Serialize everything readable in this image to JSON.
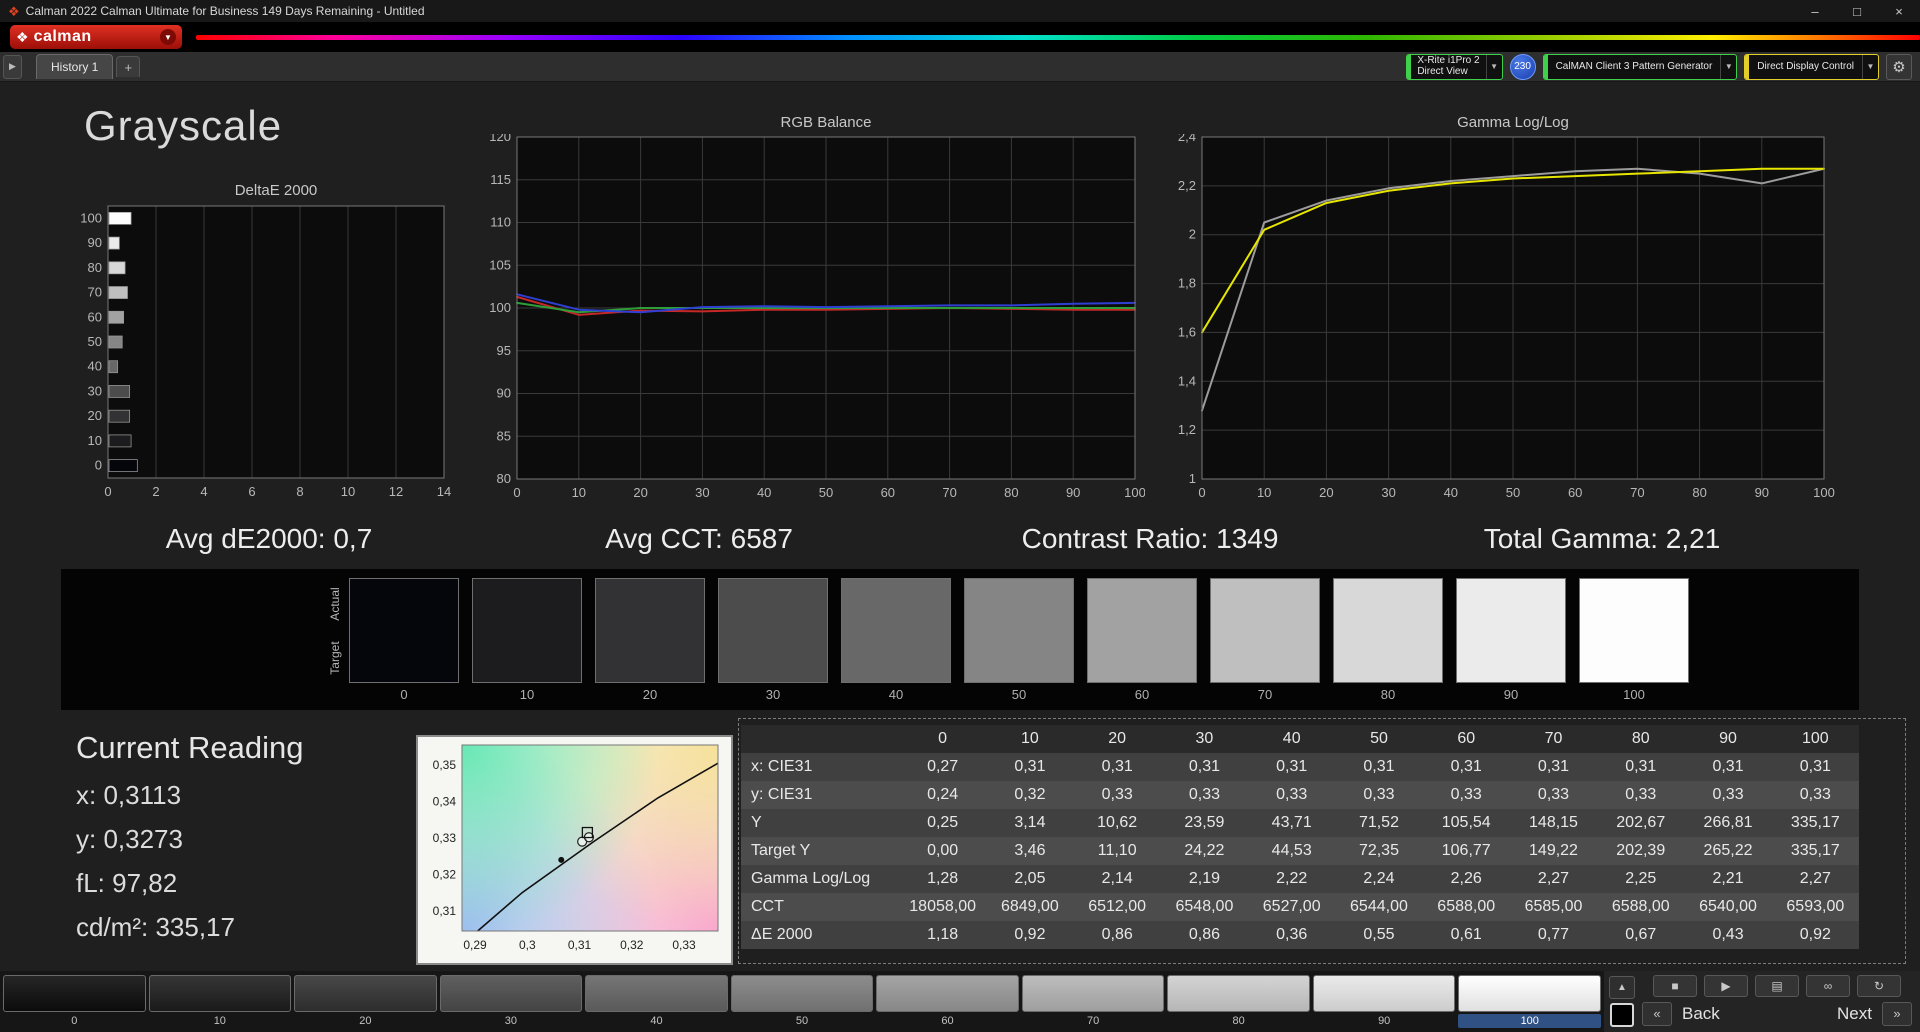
{
  "window": {
    "title": "Calman 2022 Calman Ultimate for Business 149 Days Remaining  - Untitled"
  },
  "brand": {
    "wordmark": "calman"
  },
  "icons": {
    "app": "❖",
    "minimize": "–",
    "maximize": "□",
    "close": "×",
    "chevron_down": "▼",
    "tab_arrow": "▶",
    "plus": "+",
    "gear": "⚙",
    "eject": "▲",
    "stop": "■",
    "play": "▶",
    "save": "▤",
    "infinity": "∞",
    "refresh": "↻",
    "back_chevrons": "«",
    "next_chevrons": "»"
  },
  "toolbar": {
    "history_tab": "History 1",
    "meter_line1": "X-Rite i1Pro 2",
    "meter_line2": "Direct View",
    "meter_badge": "230",
    "pattern_generator": "CalMAN Client 3 Pattern Generator",
    "display_control": "Direct Display Control"
  },
  "colors": {
    "accent_green": "#3fd14a",
    "accent_yellow": "#e3cf2a",
    "badge_blue": "#2255cc",
    "brand_red": "#c0150c"
  },
  "page": {
    "title": "Grayscale"
  },
  "stats": [
    "Avg dE2000: 0,7",
    "Avg CCT: 6587",
    "Contrast Ratio: 1349",
    "Total Gamma: 2,21"
  ],
  "swatch_strip": {
    "actual_label": "Actual",
    "target_label": "Target",
    "levels": [
      "0",
      "10",
      "20",
      "30",
      "40",
      "50",
      "60",
      "70",
      "80",
      "90",
      "100"
    ],
    "colors": [
      "#05050c",
      "#1c1c1e",
      "#323234",
      "#4c4c4c",
      "#686868",
      "#858585",
      "#a2a2a2",
      "#bfbfbf",
      "#d8d8d8",
      "#ebebeb",
      "#fdfdfd"
    ]
  },
  "current_reading": {
    "title": "Current Reading",
    "lines": [
      "x: 0,3113",
      "y: 0,3273",
      "fL: 97,82",
      "cd/m²: 335,17"
    ]
  },
  "table": {
    "columns": [
      "0",
      "10",
      "20",
      "30",
      "40",
      "50",
      "60",
      "70",
      "80",
      "90",
      "100"
    ],
    "rows": [
      {
        "label": "x: CIE31",
        "values": [
          "0,27",
          "0,31",
          "0,31",
          "0,31",
          "0,31",
          "0,31",
          "0,31",
          "0,31",
          "0,31",
          "0,31",
          "0,31"
        ]
      },
      {
        "label": "y: CIE31",
        "values": [
          "0,24",
          "0,32",
          "0,33",
          "0,33",
          "0,33",
          "0,33",
          "0,33",
          "0,33",
          "0,33",
          "0,33",
          "0,33"
        ]
      },
      {
        "label": "Y",
        "values": [
          "0,25",
          "3,14",
          "10,62",
          "23,59",
          "43,71",
          "71,52",
          "105,54",
          "148,15",
          "202,67",
          "266,81",
          "335,17"
        ]
      },
      {
        "label": "Target Y",
        "values": [
          "0,00",
          "3,46",
          "11,10",
          "24,22",
          "44,53",
          "72,35",
          "106,77",
          "149,22",
          "202,39",
          "265,22",
          "335,17"
        ]
      },
      {
        "label": "Gamma Log/Log",
        "values": [
          "1,28",
          "2,05",
          "2,14",
          "2,19",
          "2,22",
          "2,24",
          "2,26",
          "2,27",
          "2,25",
          "2,21",
          "2,27"
        ]
      },
      {
        "label": "CCT",
        "values": [
          "18058,00",
          "6849,00",
          "6512,00",
          "6548,00",
          "6527,00",
          "6544,00",
          "6588,00",
          "6585,00",
          "6588,00",
          "6540,00",
          "6593,00"
        ]
      },
      {
        "label": "ΔE 2000",
        "values": [
          "1,18",
          "0,92",
          "0,86",
          "0,86",
          "0,36",
          "0,55",
          "0,61",
          "0,77",
          "0,67",
          "0,43",
          "0,92"
        ]
      }
    ]
  },
  "bottom_bar": {
    "back": "Back",
    "next": "Next",
    "patches": [
      {
        "label": "0",
        "color": "#0d0d0d"
      },
      {
        "label": "10",
        "color": "#1e1e1e"
      },
      {
        "label": "20",
        "color": "#333333"
      },
      {
        "label": "30",
        "color": "#4d4d4d"
      },
      {
        "label": "40",
        "color": "#666666"
      },
      {
        "label": "50",
        "color": "#808080"
      },
      {
        "label": "60",
        "color": "#9a9a9a"
      },
      {
        "label": "70",
        "color": "#b5b5b5"
      },
      {
        "label": "80",
        "color": "#cfcfcf"
      },
      {
        "label": "90",
        "color": "#e8e8e8"
      },
      {
        "label": "100",
        "color": "#ffffff",
        "selected": true
      }
    ]
  },
  "chart_data": [
    {
      "id": "deltae",
      "type": "bar",
      "title": "DeltaE 2000",
      "orientation": "horizontal",
      "categories": [
        0,
        10,
        20,
        30,
        40,
        50,
        60,
        70,
        80,
        90,
        100
      ],
      "values": [
        1.18,
        0.92,
        0.86,
        0.86,
        0.36,
        0.55,
        0.61,
        0.77,
        0.67,
        0.43,
        0.92
      ],
      "xlim": [
        0,
        14
      ],
      "xticks": [
        0,
        2,
        4,
        6,
        8,
        10,
        12,
        14
      ],
      "grid": true,
      "legend": "none"
    },
    {
      "id": "rgb-balance",
      "type": "line",
      "title": "RGB Balance",
      "x": [
        0,
        10,
        20,
        30,
        40,
        50,
        60,
        70,
        80,
        90,
        100
      ],
      "series": [
        {
          "name": "Red",
          "color": "#c62828",
          "values": [
            101.3,
            99.2,
            99.7,
            99.6,
            99.8,
            99.8,
            99.9,
            100.0,
            99.9,
            99.8,
            99.8
          ]
        },
        {
          "name": "Green",
          "color": "#2e9e38",
          "values": [
            100.6,
            99.5,
            100.0,
            100.0,
            100.0,
            100.0,
            100.0,
            100.0,
            100.0,
            100.0,
            100.0
          ]
        },
        {
          "name": "Blue",
          "color": "#2f3fd4",
          "values": [
            101.6,
            99.8,
            99.5,
            100.1,
            100.2,
            100.1,
            100.2,
            100.3,
            100.3,
            100.5,
            100.6
          ]
        }
      ],
      "ylim": [
        80,
        120
      ],
      "yticks": [
        80,
        85,
        90,
        95,
        100,
        105,
        110,
        115,
        120
      ],
      "ytick_labels": [
        "80",
        "85",
        "90",
        "95",
        "100",
        "105",
        "110",
        "115",
        "120"
      ],
      "xticks": [
        0,
        10,
        20,
        30,
        40,
        50,
        60,
        70,
        80,
        90,
        100
      ],
      "grid": true,
      "legend": "none"
    },
    {
      "id": "gamma-loglog",
      "type": "line",
      "title": "Gamma Log/Log",
      "x": [
        0,
        10,
        20,
        30,
        40,
        50,
        60,
        70,
        80,
        90,
        100
      ],
      "series": [
        {
          "name": "Measured",
          "color": "#9c9c9c",
          "values": [
            1.28,
            2.05,
            2.14,
            2.19,
            2.22,
            2.24,
            2.26,
            2.27,
            2.25,
            2.21,
            2.27
          ]
        },
        {
          "name": "Target",
          "color": "#e6e600",
          "values": [
            1.6,
            2.02,
            2.13,
            2.18,
            2.21,
            2.23,
            2.24,
            2.25,
            2.26,
            2.27,
            2.27
          ]
        }
      ],
      "ylim": [
        1.0,
        2.4
      ],
      "yticks": [
        1.0,
        1.2,
        1.4,
        1.6,
        1.8,
        2.0,
        2.2,
        2.4
      ],
      "ytick_labels": [
        "1",
        "1,2",
        "1,4",
        "1,6",
        "1,8",
        "2",
        "2,2",
        "2,4"
      ],
      "xticks": [
        0,
        10,
        20,
        30,
        40,
        50,
        60,
        70,
        80,
        90,
        100
      ],
      "grid": true,
      "legend": "none"
    },
    {
      "id": "cie-xy",
      "type": "scatter",
      "title": "CIE 1931 xy",
      "xlim": [
        0.2875,
        0.3365
      ],
      "ylim": [
        0.3045,
        0.3555
      ],
      "xtick_vals": [
        0.29,
        0.3,
        0.31,
        0.32,
        0.33
      ],
      "xticks": [
        "0,29",
        "0,3",
        "0,31",
        "0,32",
        "0,33"
      ],
      "ytick_vals": [
        0.35,
        0.34,
        0.33,
        0.32,
        0.31
      ],
      "yticks": [
        "0,35",
        "0,34",
        "0,33",
        "0,32",
        "0,31"
      ],
      "locus": [
        [
          0.2905,
          0.3045
        ],
        [
          0.299,
          0.315
        ],
        [
          0.3127,
          0.329
        ],
        [
          0.325,
          0.341
        ],
        [
          0.3365,
          0.3505
        ]
      ],
      "target": [
        0.3115,
        0.3315
      ],
      "points": [
        [
          0.3105,
          0.329
        ],
        [
          0.3118,
          0.3302
        ]
      ],
      "dot": [
        0.3065,
        0.324
      ]
    }
  ]
}
